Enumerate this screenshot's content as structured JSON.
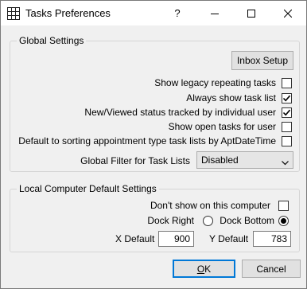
{
  "window": {
    "title": "Tasks Preferences"
  },
  "titlebar": {
    "help": "?"
  },
  "global_settings": {
    "legend": "Global Settings",
    "inbox_setup_label": "Inbox Setup",
    "options": [
      {
        "label": "Show legacy repeating tasks",
        "checked": false
      },
      {
        "label": "Always show task list",
        "checked": true
      },
      {
        "label": "New/Viewed status tracked by individual user",
        "checked": true
      },
      {
        "label": "Show open tasks for user",
        "checked": false
      },
      {
        "label": "Default to sorting appointment type task lists by AptDateTime",
        "checked": false
      }
    ],
    "filter_label": "Global Filter for Task Lists",
    "filter_value": "Disabled"
  },
  "local_settings": {
    "legend": "Local Computer Default Settings",
    "dont_show_label": "Don't show on this computer",
    "dont_show_checked": false,
    "dock_right_label": "Dock Right",
    "dock_right_selected": false,
    "dock_bottom_label": "Dock Bottom",
    "dock_bottom_selected": true,
    "x_default_label": "X Default",
    "x_default_value": "900",
    "y_default_label": "Y Default",
    "y_default_value": "783"
  },
  "buttons": {
    "ok_mnemonic": "O",
    "ok_rest": "K",
    "cancel_label": "Cancel"
  }
}
